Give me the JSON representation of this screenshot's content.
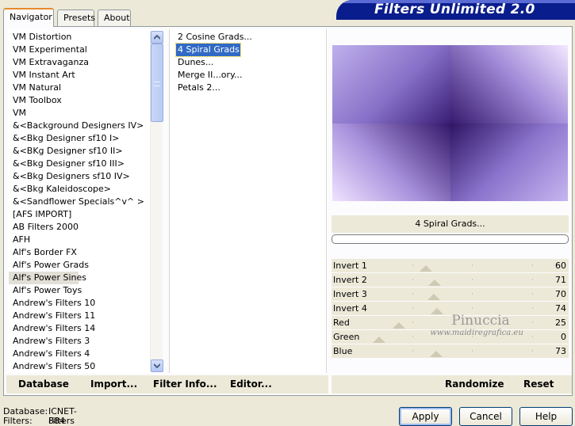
{
  "tabs": [
    "Navigator",
    "Presets",
    "About"
  ],
  "banner_title": "Filters Unlimited 2.0",
  "categories": [
    "VM Distortion",
    "VM Experimental",
    "VM Extravaganza",
    "VM Instant Art",
    "VM Natural",
    "VM Toolbox",
    "VM",
    "&<Background Designers IV>",
    "&<Bkg Designer sf10 I>",
    "&<BKg Designer sf10 II>",
    "&<Bkg Designer sf10 III>",
    "&<Bkg Designers sf10 IV>",
    "&<Bkg Kaleidoscope>",
    "&<Sandflower Specials^v^ >",
    "[AFS IMPORT]",
    "AB Filters 2000",
    "AFH",
    "Alf's Border FX",
    "Alf's Power Grads",
    "Alf's Power Sines",
    "Alf's Power Toys",
    "Andrew's Filters 10",
    "Andrew's Filters 11",
    "Andrew's Filters 14",
    "Andrew's Filters 3",
    "Andrew's Filters 4",
    "Andrew's Filters 50"
  ],
  "selected_category": "Alf's Power Sines",
  "filters": [
    "2 Cosine Grads...",
    "4 Spiral Grads...",
    "Dunes...",
    "Merge II...ory...",
    "Petals 2..."
  ],
  "selected_filter": "4 Spiral Grads...",
  "filter_name": "4 Spiral Grads...",
  "params": [
    {
      "label": "Invert 1",
      "value": 60
    },
    {
      "label": "Invert 2",
      "value": 71
    },
    {
      "label": "Invert 3",
      "value": 70
    },
    {
      "label": "Invert 4",
      "value": 74
    },
    {
      "label": "Red",
      "value": 25
    },
    {
      "label": "Green",
      "value": 0
    },
    {
      "label": "Blue",
      "value": 73
    }
  ],
  "watermark": {
    "line1": "Pinuccia",
    "line2": "www.maidiregrafica.eu"
  },
  "bottom": {
    "database": "Database",
    "import": "Import...",
    "filter_info": "Filter Info...",
    "editor": "Editor...",
    "randomize": "Randomize",
    "reset": "Reset"
  },
  "status": {
    "db_label": "Database:",
    "db_value": "ICNET-Filters",
    "filters_label": "Filters:",
    "filters_value": "884"
  },
  "buttons": {
    "apply": "Apply",
    "cancel": "Cancel",
    "help": "Help"
  },
  "colors": {
    "banner": "#0a1d8c",
    "selection": "#316ac5",
    "tab_accent": "#e68b2c"
  }
}
